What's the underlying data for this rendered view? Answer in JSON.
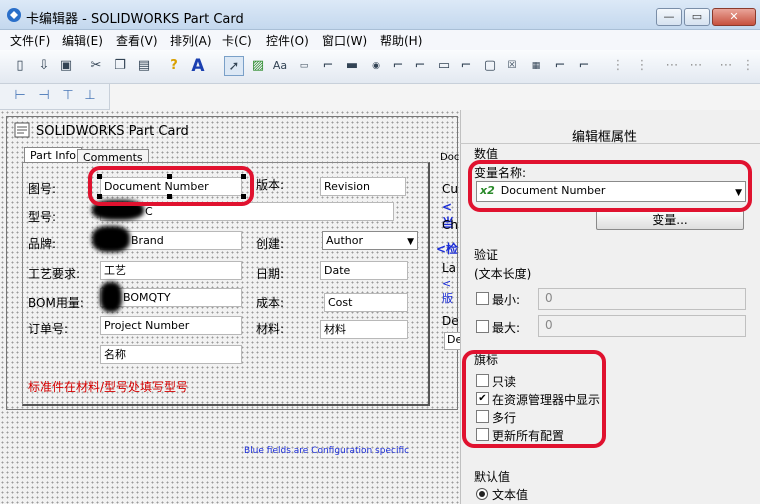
{
  "app": {
    "title": "卡编辑器 - SOLIDWORKS Part Card",
    "min": "—",
    "max": "▭",
    "close": "✕"
  },
  "menu": [
    "文件(F)",
    "编辑(E)",
    "查看(V)",
    "排列(A)",
    "卡(C)",
    "控件(O)",
    "窗口(W)",
    "帮助(H)"
  ],
  "card": {
    "title": "SOLIDWORKS Part Card",
    "tabs": [
      "Part Info",
      "Comments"
    ],
    "labels": {
      "tuhao": "图号:",
      "banben": "版本:",
      "xinghao": "型号:",
      "pinpai": "品牌:",
      "chuangjian": "创建:",
      "gongyi": "工艺要求:",
      "riqi": "日期:",
      "bom": "BOM用量:",
      "chengben": "成本:",
      "dingdan": "订单号:",
      "cailiao": "材料:"
    },
    "fields": {
      "doc_number": "Document Number",
      "revision": "Revision",
      "model": "C",
      "brand": "Brand",
      "author": "Author",
      "craft": "工艺",
      "date": "Date",
      "bomqty": "BOMQTY",
      "cost": "Cost",
      "project": "Project Number",
      "material": "材料",
      "name": "名称"
    },
    "red_note": "标准件在材料/型号处填写型号",
    "blue_note": "Blue fields are Configuration specific",
    "right_partial": [
      "Doc",
      "Cu",
      "<当",
      "Ch",
      "<检",
      "La",
      "<版",
      "De",
      "De"
    ]
  },
  "panel": {
    "title": "编辑框属性",
    "value_section": "数值",
    "var_name_label": "变量名称:",
    "var_badge": "x2",
    "var_name": "Document Number",
    "var_button": "变量...",
    "validate_section": "验证",
    "text_length": "(文本长度)",
    "min_label": "最小:",
    "min_value": "0",
    "max_label": "最大:",
    "max_value": "0",
    "flags_section": "旗标",
    "flags": [
      {
        "label": "只读",
        "checked": false
      },
      {
        "label": "在资源管理器中显示",
        "checked": true
      },
      {
        "label": "多行",
        "checked": false
      },
      {
        "label": "更新所有配置",
        "checked": false
      }
    ],
    "default_section": "默认值",
    "default_option": "文本值"
  },
  "colors": {
    "highlight": "#e0122f",
    "red_note": "#d40000",
    "blue_note": "#1a2cd8"
  }
}
